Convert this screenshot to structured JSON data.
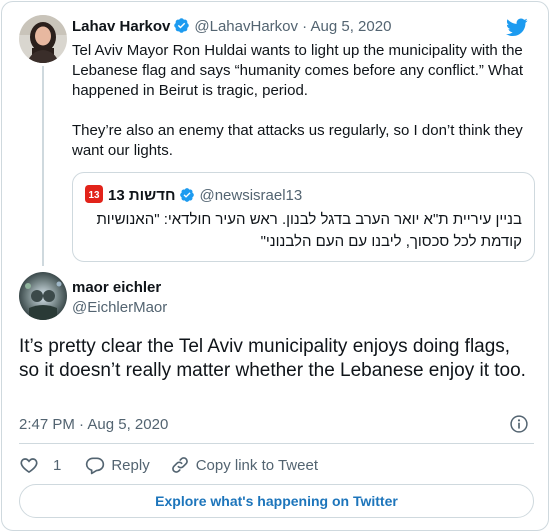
{
  "colors": {
    "accent": "#1d9bf0",
    "link_text": "#1d75bb",
    "secondary_text": "#536471",
    "border": "#cfd9de",
    "brand_red": "#e2231a"
  },
  "parent_tweet": {
    "author_name": "Lahav Harkov",
    "verified_icon": "verified-badge-icon",
    "handle": "@LahavHarkov",
    "separator": "·",
    "date": "Aug 5, 2020",
    "paragraphs": [
      "Tel Aviv Mayor Ron Huldai wants to light up the municipality with the Lebanese flag and says “humanity comes before any conflict.” What happened in Beirut is tragic, period.",
      "They’re also an enemy that attacks us regularly, so I don’t think they want our lights."
    ],
    "quoted_tweet": {
      "author_name": "חדשות 13",
      "logo_icon": "channel-13-logo-icon",
      "verified_icon": "verified-badge-icon",
      "handle": "@newsisrael13",
      "text": "בניין עיריית ת\"א יואר הערב בדגל לבנון. ראש העיר חולדאי: \"האנושיות קודמת לכל סכסוך, ליבנו עם העם הלבנוני\""
    }
  },
  "reply_tweet": {
    "author_name": "maor eichler",
    "handle": "@EichlerMaor",
    "text": "It’s pretty clear the Tel Aviv municipality enjoys doing flags, so it doesn’t really matter whether the Lebanese enjoy it too.",
    "time": "2:47 PM",
    "separator": "·",
    "date": "Aug 5, 2020",
    "actions": {
      "like_icon": "heart-icon",
      "like_count": "1",
      "reply_icon": "reply-bubble-icon",
      "reply_label": "Reply",
      "copy_icon": "link-icon",
      "copy_label": "Copy link to Tweet"
    }
  },
  "footer": {
    "explore_label": "Explore what's happening on Twitter"
  },
  "icons": {
    "brand": "twitter-bird-icon",
    "info": "info-icon"
  }
}
